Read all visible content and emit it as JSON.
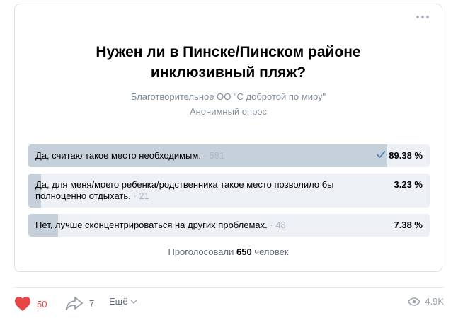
{
  "poll": {
    "title": "Нужен ли в Пинске/Пинском районе инклюзивный пляж?",
    "author": "Благотворительное ОО \"С добротой по миру\"",
    "type_label": "Анонимный опрос",
    "options": [
      {
        "label": "Да, считаю такое место необходимым.",
        "count": "· 581",
        "percent_text": "89.38 %",
        "percent": 89.38,
        "selected": true
      },
      {
        "label": "Да, для меня/моего ребенка/родственника такое место позволило бы полноценно отдыхать.",
        "count": "· 21",
        "percent_text": "3.23 %",
        "percent": 3.23,
        "selected": false
      },
      {
        "label": "Нет, лучше сконцентрироваться на других проблемах.",
        "count": "· 48",
        "percent_text": "7.38 %",
        "percent": 7.38,
        "selected": false
      }
    ],
    "total_prefix": "Проголосовали ",
    "total_count": "650",
    "total_suffix": " человек"
  },
  "footer": {
    "likes": "50",
    "shares": "7",
    "more_label": "Ещё",
    "views": "4.9K"
  },
  "colors": {
    "like_red": "#e64646",
    "bar_fill": "#c5d0db",
    "bar_bg": "#edf0f4",
    "check_blue": "#5181b8"
  }
}
